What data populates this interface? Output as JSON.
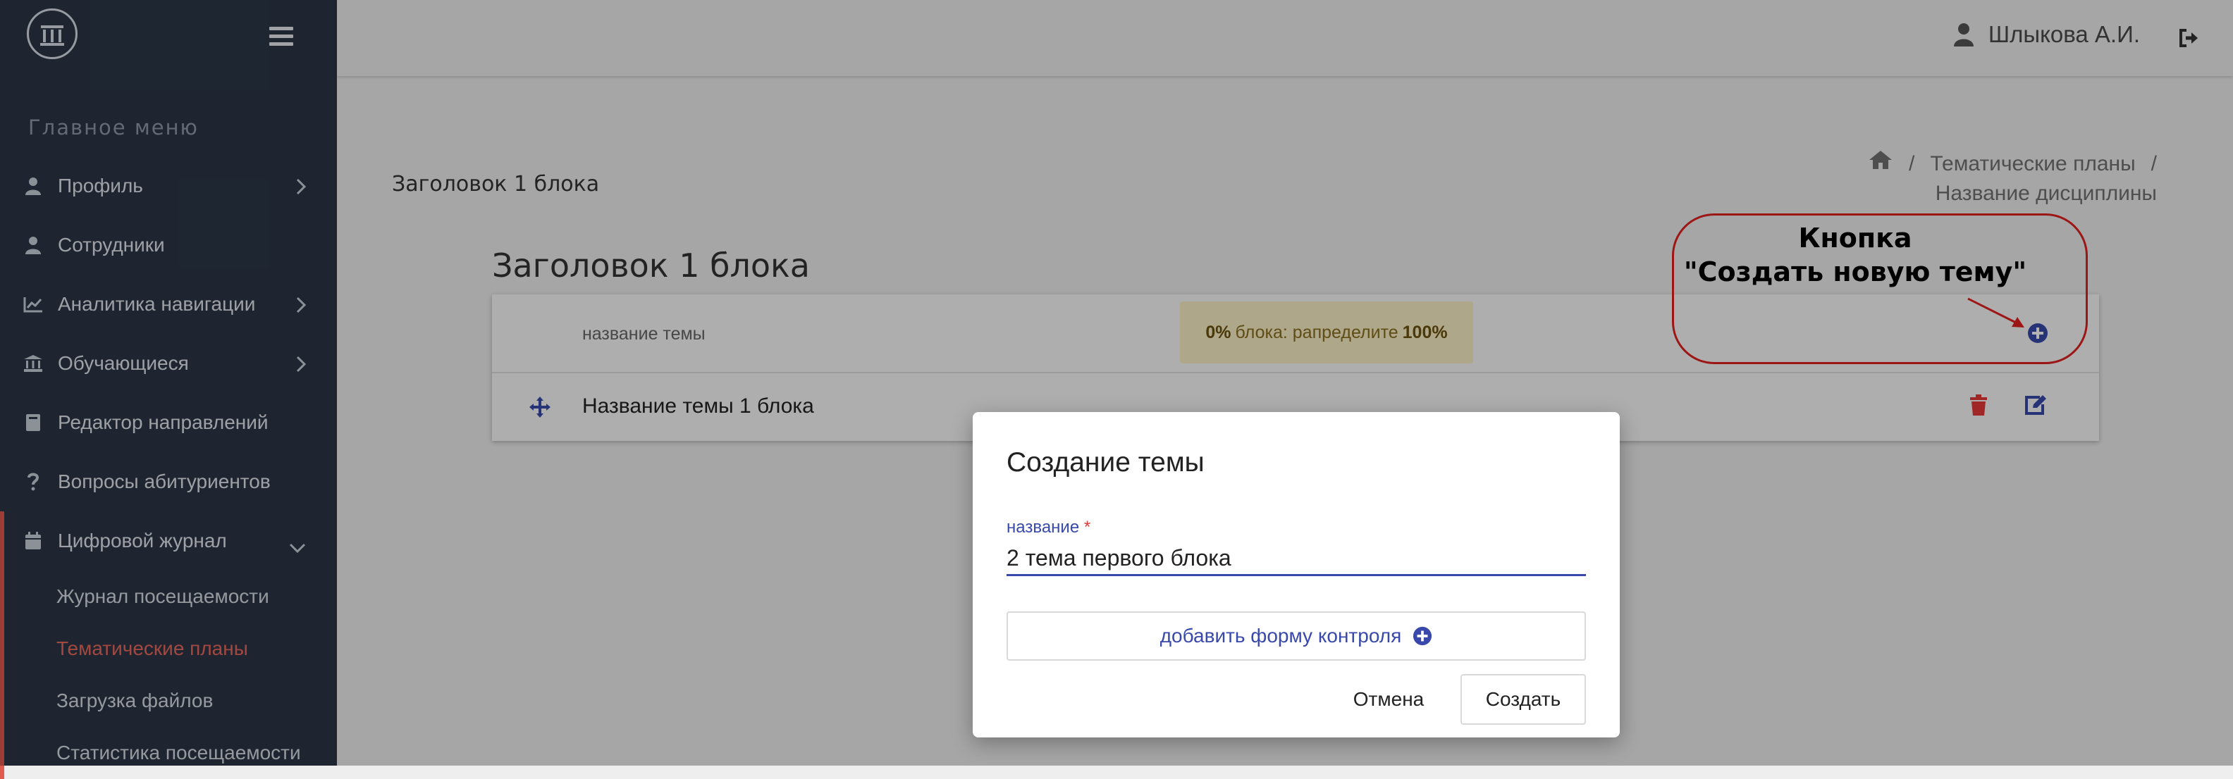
{
  "sidebar": {
    "menu_title": "Главное меню",
    "items": [
      {
        "label": "Профиль",
        "icon": "user-icon"
      },
      {
        "label": "Сотрудники",
        "icon": "users-icon"
      },
      {
        "label": "Аналитика навигации",
        "icon": "chart-line-icon"
      },
      {
        "label": "Обучающиеся",
        "icon": "university-icon"
      },
      {
        "label": "Редактор направлений",
        "icon": "book-icon"
      },
      {
        "label": "Вопросы абитуриентов",
        "icon": "question-icon"
      },
      {
        "label": "Цифровой журнал",
        "icon": "calendar-icon"
      }
    ],
    "submenu": [
      {
        "label": "Журнал посещаемости"
      },
      {
        "label": "Тематические планы"
      },
      {
        "label": "Загрузка файлов"
      },
      {
        "label": "Статистика посещаемости"
      }
    ]
  },
  "topbar": {
    "user_name": "Шлыкова А.И."
  },
  "breadcrumb": {
    "sep": "/",
    "item1": "Тематические планы",
    "sep2": "/",
    "item2": "Название дисциплины"
  },
  "page": {
    "small_title": "Заголовок 1 блока",
    "block_title": "Заголовок 1 блока"
  },
  "table": {
    "column_name": "название темы",
    "quota_percent": "0%",
    "quota_text": "блока: рапределите",
    "quota_total": "100%",
    "rows": [
      {
        "name": "Название темы 1 блока"
      }
    ]
  },
  "annotation": {
    "line1": "Кнопка",
    "line2": "\"Создать новую тему\""
  },
  "modal": {
    "title": "Создание темы",
    "field_label": "название",
    "required_mark": "*",
    "field_value": "2 тема первого блока",
    "add_control_label": "добавить форму контроля",
    "cancel_label": "Отмена",
    "create_label": "Создать"
  },
  "colors": {
    "sidebar_bg": "#2b3647",
    "accent": "#3949ab",
    "active": "#e8685b",
    "danger": "#e53935",
    "annotation": "#e02020"
  }
}
